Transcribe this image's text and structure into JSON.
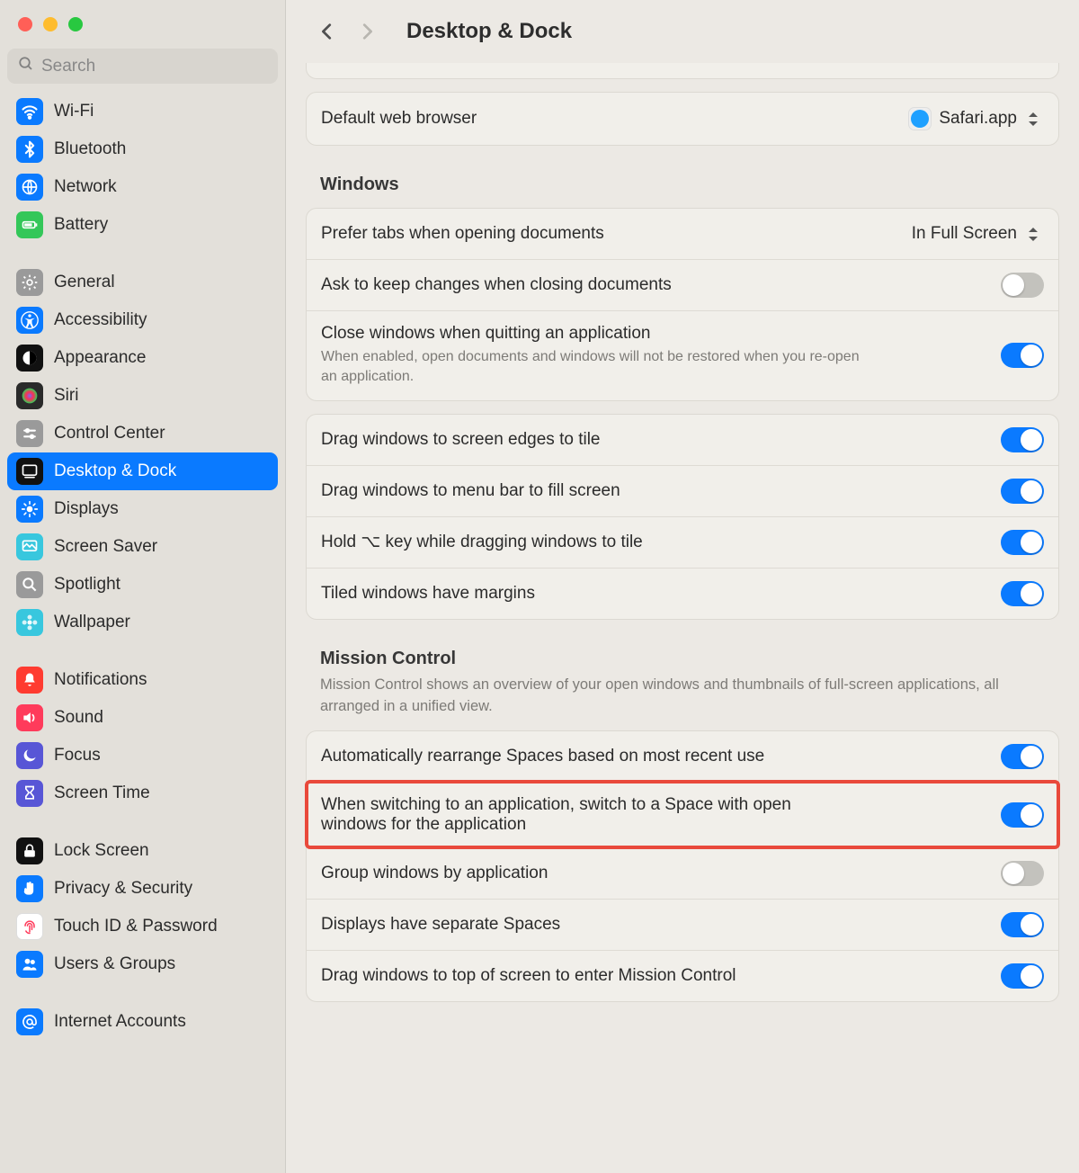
{
  "search": {
    "placeholder": "Search"
  },
  "sidebar": [
    {
      "label": "Wi-Fi",
      "color": "#0a7aff",
      "icon": "wifi"
    },
    {
      "label": "Bluetooth",
      "color": "#0a7aff",
      "icon": "bluetooth"
    },
    {
      "label": "Network",
      "color": "#0a7aff",
      "icon": "globe"
    },
    {
      "label": "Battery",
      "color": "#34c759",
      "icon": "battery"
    },
    {
      "gap": true
    },
    {
      "label": "General",
      "color": "#9a9a9a",
      "icon": "gear"
    },
    {
      "label": "Accessibility",
      "color": "#0a7aff",
      "icon": "accessibility"
    },
    {
      "label": "Appearance",
      "color": "#111111",
      "icon": "appearance"
    },
    {
      "label": "Siri",
      "color": "#2a2a2a",
      "icon": "siri"
    },
    {
      "label": "Control Center",
      "color": "#9a9a9a",
      "icon": "sliders"
    },
    {
      "label": "Desktop & Dock",
      "color": "#111111",
      "icon": "dock",
      "selected": true
    },
    {
      "label": "Displays",
      "color": "#0a7aff",
      "icon": "sun"
    },
    {
      "label": "Screen Saver",
      "color": "#38c7de",
      "icon": "screensaver"
    },
    {
      "label": "Spotlight",
      "color": "#9a9a9a",
      "icon": "search"
    },
    {
      "label": "Wallpaper",
      "color": "#38c7de",
      "icon": "flower"
    },
    {
      "gap": true
    },
    {
      "label": "Notifications",
      "color": "#ff3b30",
      "icon": "bell"
    },
    {
      "label": "Sound",
      "color": "#ff3b5b",
      "icon": "speaker"
    },
    {
      "label": "Focus",
      "color": "#5856d6",
      "icon": "moon"
    },
    {
      "label": "Screen Time",
      "color": "#5856d6",
      "icon": "hourglass"
    },
    {
      "gap": true
    },
    {
      "label": "Lock Screen",
      "color": "#111111",
      "icon": "lock"
    },
    {
      "label": "Privacy & Security",
      "color": "#0a7aff",
      "icon": "hand"
    },
    {
      "label": "Touch ID & Password",
      "color": "#ffffff",
      "icon": "fingerprint",
      "iconColor": "#ff3b5b",
      "border": true
    },
    {
      "label": "Users & Groups",
      "color": "#0a7aff",
      "icon": "users"
    },
    {
      "gap": true
    },
    {
      "label": "Internet Accounts",
      "color": "#0a7aff",
      "icon": "at"
    }
  ],
  "header": {
    "title": "Desktop & Dock"
  },
  "browser": {
    "label": "Default web browser",
    "value": "Safari.app"
  },
  "windows": {
    "title": "Windows",
    "preferTabs": {
      "label": "Prefer tabs when opening documents",
      "value": "In Full Screen"
    },
    "askKeep": {
      "label": "Ask to keep changes when closing documents",
      "on": false
    },
    "closeQuit": {
      "label": "Close windows when quitting an application",
      "desc": "When enabled, open documents and windows will not be restored when you re-open an application.",
      "on": true
    },
    "dragEdges": {
      "label": "Drag windows to screen edges to tile",
      "on": true
    },
    "dragMenu": {
      "label": "Drag windows to menu bar to fill screen",
      "on": true
    },
    "holdOpt": {
      "label": "Hold ⌥ key while dragging windows to tile",
      "on": true
    },
    "margins": {
      "label": "Tiled windows have margins",
      "on": true
    }
  },
  "mission": {
    "title": "Mission Control",
    "desc": "Mission Control shows an overview of your open windows and thumbnails of full-screen applications, all arranged in a unified view.",
    "autoArrange": {
      "label": "Automatically rearrange Spaces based on most recent use",
      "on": true
    },
    "switchSpace": {
      "label": "When switching to an application, switch to a Space with open windows for the application",
      "on": true,
      "highlight": true
    },
    "groupByApp": {
      "label": "Group windows by application",
      "on": false
    },
    "separateDisp": {
      "label": "Displays have separate Spaces",
      "on": true
    },
    "dragTop": {
      "label": "Drag windows to top of screen to enter Mission Control",
      "on": true
    }
  }
}
